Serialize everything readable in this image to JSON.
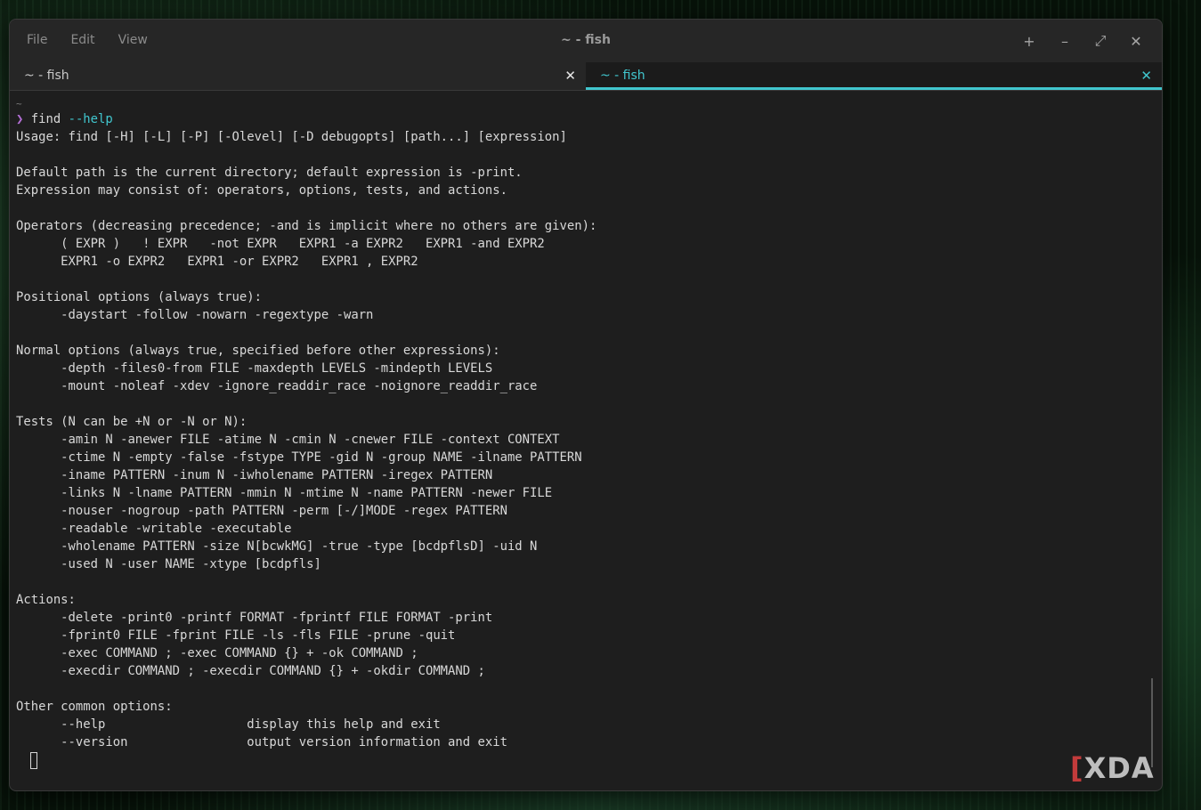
{
  "window": {
    "title": "~ - fish",
    "menu": [
      "File",
      "Edit",
      "View"
    ],
    "controls": [
      {
        "name": "new-tab-icon",
        "glyph": "+"
      },
      {
        "name": "minimize-icon",
        "glyph": "–"
      },
      {
        "name": "maximize-icon",
        "glyph": "⤢"
      },
      {
        "name": "close-icon",
        "glyph": "✕"
      }
    ]
  },
  "tabs": [
    {
      "label": "~ - fish",
      "active": false,
      "close": "✕"
    },
    {
      "label": "~ - fish",
      "active": true,
      "close": "✕"
    }
  ],
  "terminal": {
    "cwd": "~",
    "prompt_symbol": "❯",
    "command": "find",
    "command_arg": "--help",
    "output": [
      "Usage: find [-H] [-L] [-P] [-Olevel] [-D debugopts] [path...] [expression]",
      "",
      "Default path is the current directory; default expression is -print.",
      "Expression may consist of: operators, options, tests, and actions.",
      "",
      "Operators (decreasing precedence; -and is implicit where no others are given):",
      "      ( EXPR )   ! EXPR   -not EXPR   EXPR1 -a EXPR2   EXPR1 -and EXPR2",
      "      EXPR1 -o EXPR2   EXPR1 -or EXPR2   EXPR1 , EXPR2",
      "",
      "Positional options (always true):",
      "      -daystart -follow -nowarn -regextype -warn",
      "",
      "Normal options (always true, specified before other expressions):",
      "      -depth -files0-from FILE -maxdepth LEVELS -mindepth LEVELS",
      "      -mount -noleaf -xdev -ignore_readdir_race -noignore_readdir_race",
      "",
      "Tests (N can be +N or -N or N):",
      "      -amin N -anewer FILE -atime N -cmin N -cnewer FILE -context CONTEXT",
      "      -ctime N -empty -false -fstype TYPE -gid N -group NAME -ilname PATTERN",
      "      -iname PATTERN -inum N -iwholename PATTERN -iregex PATTERN",
      "      -links N -lname PATTERN -mmin N -mtime N -name PATTERN -newer FILE",
      "      -nouser -nogroup -path PATTERN -perm [-/]MODE -regex PATTERN",
      "      -readable -writable -executable",
      "      -wholename PATTERN -size N[bcwkMG] -true -type [bcdpflsD] -uid N",
      "      -used N -user NAME -xtype [bcdpfls]",
      "",
      "Actions:",
      "      -delete -print0 -printf FORMAT -fprintf FILE FORMAT -print",
      "      -fprint0 FILE -fprint FILE -ls -fls FILE -prune -quit",
      "      -exec COMMAND ; -exec COMMAND {} + -ok COMMAND ;",
      "      -execdir COMMAND ; -execdir COMMAND {} + -okdir COMMAND ;",
      "",
      "Other common options:",
      "      --help                   display this help and exit",
      "      --version                output version information and exit"
    ]
  },
  "watermark": {
    "bracket": "[",
    "text": "XDA"
  }
}
